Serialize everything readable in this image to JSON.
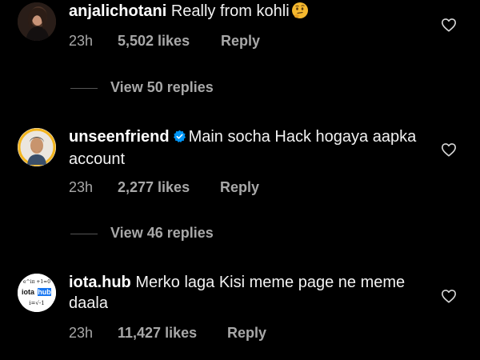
{
  "comments": [
    {
      "username": "anjalichotani",
      "text": "Really from kohli",
      "emoji": "thinking-face",
      "time": "23h",
      "likes": "5,502 likes",
      "reply": "Reply",
      "verified": false,
      "view_replies": "View 50 replies"
    },
    {
      "username": "unseenfriend",
      "text": "Main socha Hack hogaya aapka account",
      "time": "23h",
      "likes": "2,277 likes",
      "reply": "Reply",
      "verified": true,
      "view_replies": "View 46 replies"
    },
    {
      "username": "iota.hub",
      "text": "Merko laga Kisi meme page ne meme daala",
      "time": "23h",
      "likes": "11,427 likes",
      "reply": "Reply",
      "verified": false,
      "avatar_logo": {
        "top": "e^iπ +1=0",
        "brand_left": "iota",
        "brand_right": "hub",
        "bottom": "i=√-1"
      }
    }
  ],
  "colors": {
    "background": "#000000",
    "text": "#ffffff",
    "secondary": "#a8a8a8",
    "verified": "#0095f6",
    "brand": "#1877f2"
  }
}
